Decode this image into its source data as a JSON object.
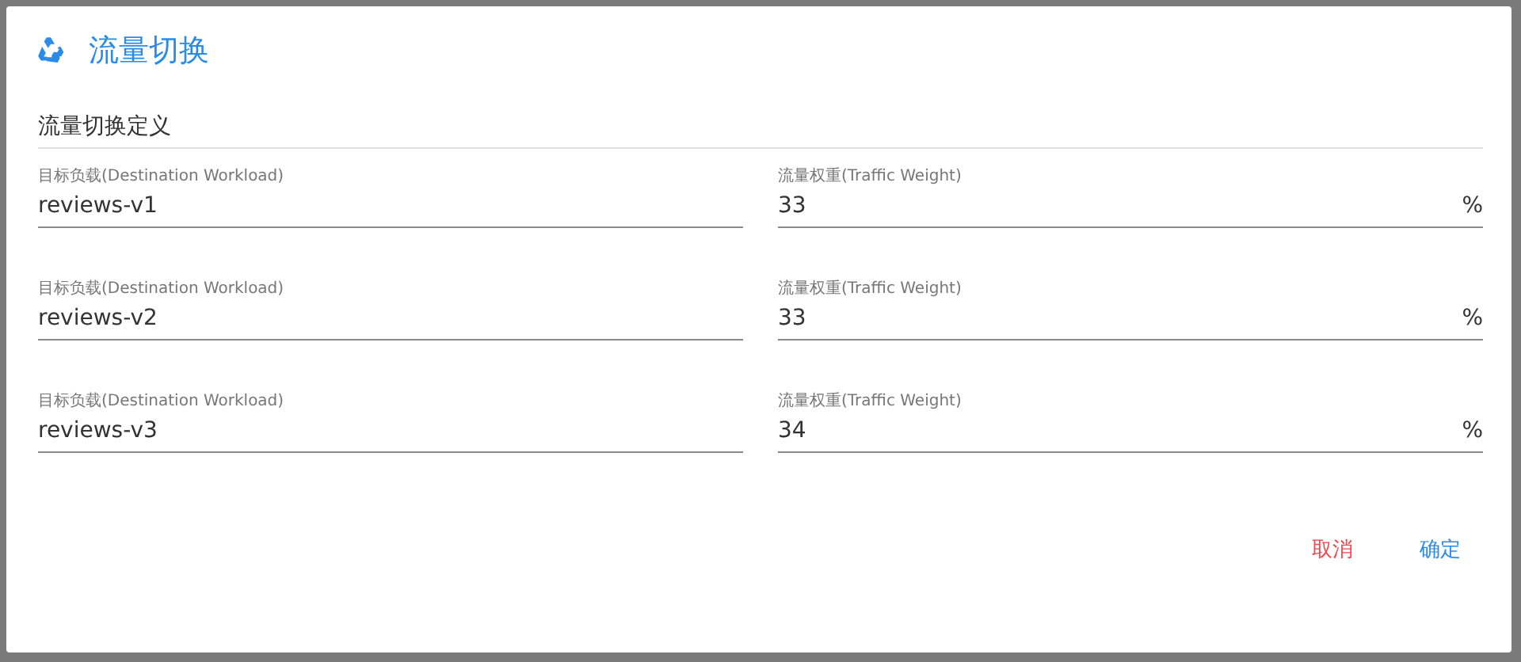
{
  "dialog": {
    "title": "流量切换"
  },
  "section": {
    "title": "流量切换定义"
  },
  "routes": [
    {
      "workload": {
        "label": "目标负载(Destination Workload)",
        "value": "reviews-v1"
      },
      "weight": {
        "label": "流量权重(Traffic Weight)",
        "value": "33",
        "suffix": "%"
      }
    },
    {
      "workload": {
        "label": "目标负载(Destination Workload)",
        "value": "reviews-v2"
      },
      "weight": {
        "label": "流量权重(Traffic Weight)",
        "value": "33",
        "suffix": "%"
      }
    },
    {
      "workload": {
        "label": "目标负载(Destination Workload)",
        "value": "reviews-v3"
      },
      "weight": {
        "label": "流量权重(Traffic Weight)",
        "value": "34",
        "suffix": "%"
      }
    }
  ],
  "buttons": [
    {
      "label": "取消",
      "kind": "cancel"
    },
    {
      "label": "确定",
      "kind": "confirm"
    }
  ]
}
